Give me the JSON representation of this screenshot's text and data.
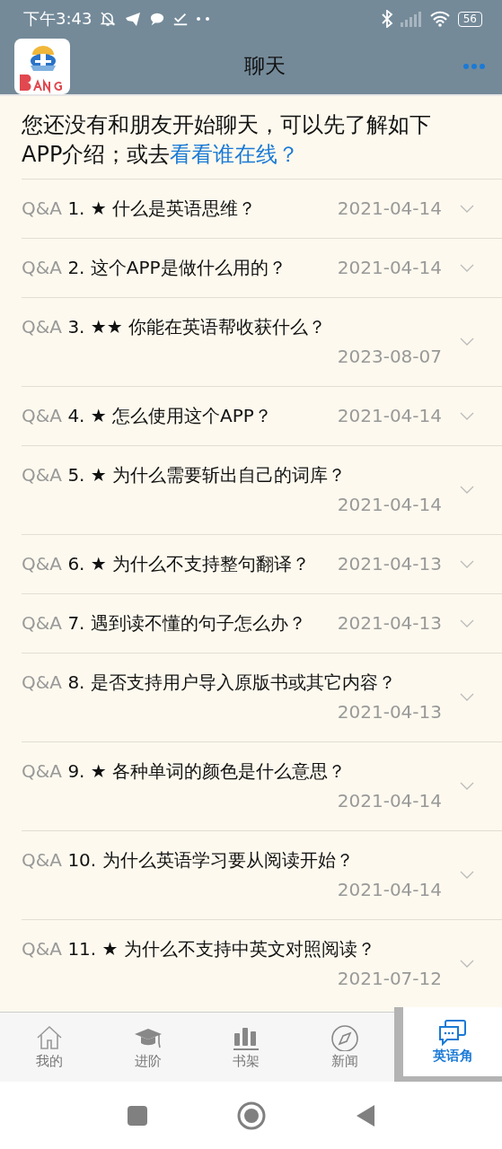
{
  "status_bar": {
    "time": "下午3:43",
    "battery": "56"
  },
  "header": {
    "title": "聊天"
  },
  "intro": {
    "text": "您还没有和朋友开始聊天，可以先了解如下APP介绍；或去",
    "link": "看看谁在线？"
  },
  "faq": [
    {
      "prefix": "Q&A",
      "title": "1. ★ 什么是英语思维？",
      "date": "2021-04-14",
      "expanded": false
    },
    {
      "prefix": "Q&A",
      "title": "2. 这个APP是做什么用的？",
      "date": "2021-04-14",
      "expanded": false
    },
    {
      "prefix": "Q&A",
      "title": "3. ★★ 你能在英语帮收获什么？",
      "date": "2023-08-07",
      "expanded": false
    },
    {
      "prefix": "Q&A",
      "title": "4. ★ 怎么使用这个APP？",
      "date": "2021-04-14",
      "expanded": false
    },
    {
      "prefix": "Q&A",
      "title": "5. ★ 为什么需要斩出自己的词库？",
      "date": "2021-04-14",
      "expanded": false
    },
    {
      "prefix": "Q&A",
      "title": "6. ★ 为什么不支持整句翻译？",
      "date": "2021-04-13",
      "expanded": false
    },
    {
      "prefix": "Q&A",
      "title": "7. 遇到读不懂的句子怎么办？",
      "date": "2021-04-13",
      "expanded": false
    },
    {
      "prefix": "Q&A",
      "title": "8. 是否支持用户导入原版书或其它内容？",
      "date": "2021-04-13",
      "expanded": false
    },
    {
      "prefix": "Q&A",
      "title": "9. ★ 各种单词的颜色是什么意思？",
      "date": "2021-04-14",
      "expanded": false
    },
    {
      "prefix": "Q&A",
      "title": "10. 为什么英语学习要从阅读开始？",
      "date": "2021-04-14",
      "expanded": false
    },
    {
      "prefix": "Q&A",
      "title": "11. ★ 为什么不支持中英文对照阅读？",
      "date": "2021-07-12",
      "expanded": false
    }
  ],
  "tabs": [
    {
      "label": "我的",
      "selected": false
    },
    {
      "label": "进阶",
      "selected": false
    },
    {
      "label": "书架",
      "selected": false
    },
    {
      "label": "新闻",
      "selected": false
    },
    {
      "label": "英语角",
      "selected": true
    }
  ]
}
